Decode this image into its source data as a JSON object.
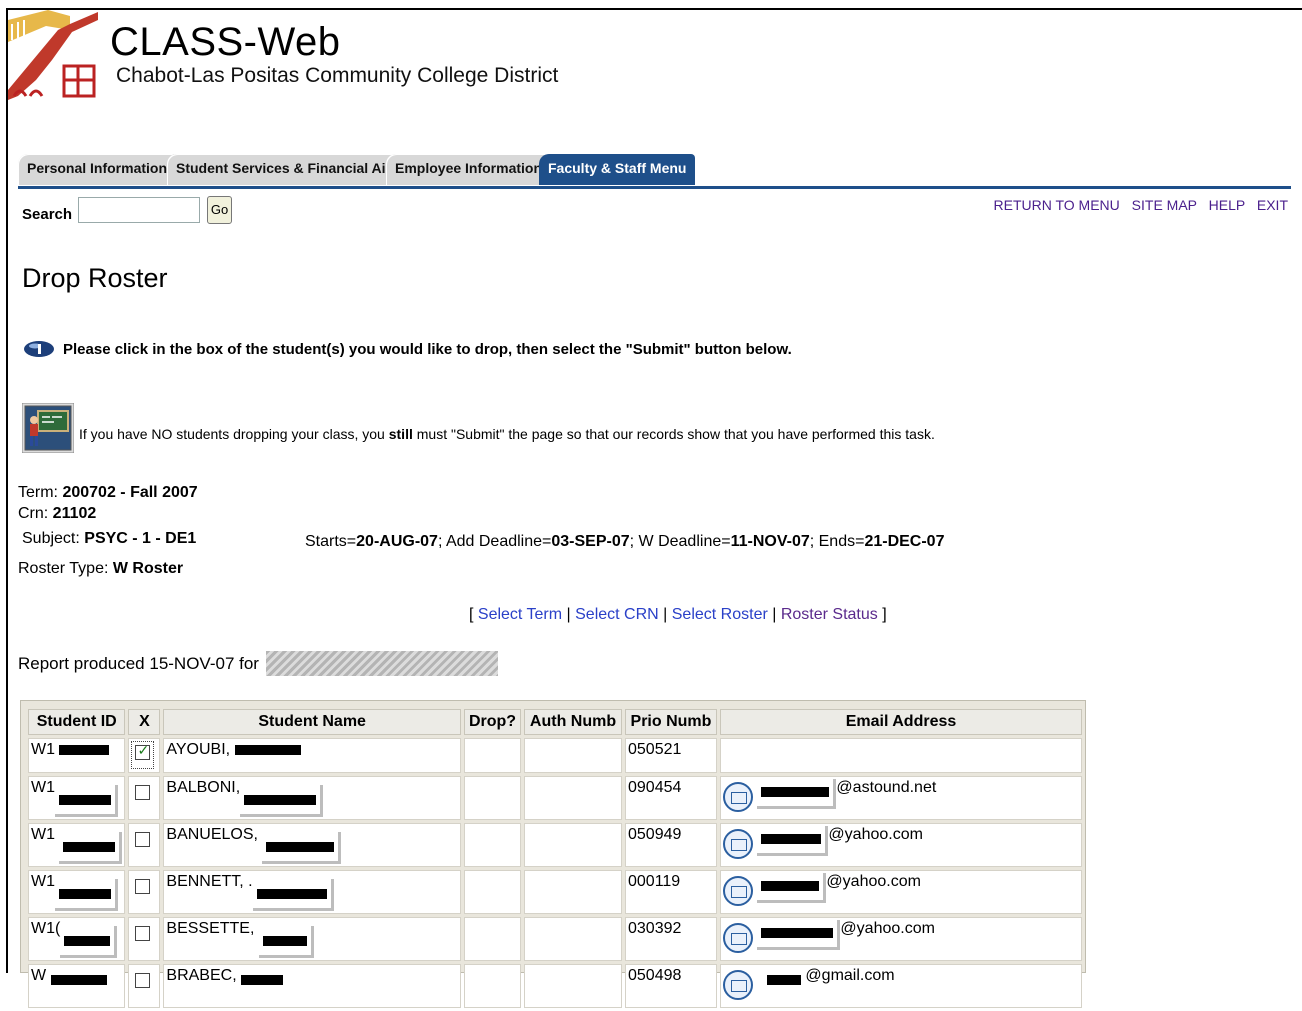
{
  "header": {
    "title": "CLASS-Web",
    "subtitle": "Chabot-Las Positas Community College District",
    "logo": "class-web-logo"
  },
  "tabs": [
    {
      "label": "Personal Information",
      "active": false
    },
    {
      "label": "Student Services & Financial Aid",
      "active": false
    },
    {
      "label": "Employee Information",
      "active": false
    },
    {
      "label": "Faculty & Staff Menu",
      "active": true
    }
  ],
  "search": {
    "label": "Search",
    "value": "",
    "go_label": "Go"
  },
  "toplinks": {
    "return": "RETURN TO MENU",
    "sitemap": "SITE MAP",
    "help": "HELP",
    "exit": "EXIT"
  },
  "page_title": "Drop Roster",
  "instruction": "Please click in the box of the student(s) you would like to drop, then select the \"Submit\" button below.",
  "note": {
    "before": "If you have NO students dropping your class, you ",
    "bold": "still",
    "after": " must \"Submit\" the page so that our records show that you have performed this task."
  },
  "course": {
    "term_label": "Term: ",
    "term": "200702 - Fall 2007",
    "crn_label": "Crn: ",
    "crn": "21102",
    "subject_label": "Subject: ",
    "subject": "PSYC - 1 - DE1",
    "roster_label": "Roster Type: ",
    "roster": "W Roster"
  },
  "dates": {
    "starts_label": "Starts=",
    "starts": "20-AUG-07",
    "add_label": "; Add Deadline=",
    "add": "03-SEP-07",
    "w_label": "; W Deadline=",
    "w": "11-NOV-07",
    "ends_label": "; Ends=",
    "ends": "21-DEC-07"
  },
  "nav_links": {
    "select_term": "Select Term",
    "select_crn": "Select CRN",
    "select_roster": "Select Roster",
    "roster_status": "Roster Status"
  },
  "report": "Report produced 15-NOV-07 for",
  "table": {
    "headers": [
      "Student ID",
      "X",
      "Student Name",
      "Drop?",
      "Auth Numb",
      "Prio Numb",
      "Email Address"
    ],
    "rows": [
      {
        "id": "W1",
        "checked": true,
        "name": "AYOUBI,",
        "prio": "050521",
        "email": ""
      },
      {
        "id": "W1",
        "checked": false,
        "name": "BALBONI,",
        "prio": "090454",
        "email": "@astound.net"
      },
      {
        "id": "W1",
        "checked": false,
        "name": "BANUELOS,",
        "prio": "050949",
        "email": "@yahoo.com"
      },
      {
        "id": "W1",
        "checked": false,
        "name": "BENNETT, .",
        "prio": "000119",
        "email": "@yahoo.com"
      },
      {
        "id": "W1(",
        "checked": false,
        "name": "BESSETTE,",
        "prio": "030392",
        "email": "@yahoo.com"
      },
      {
        "id": "W",
        "checked": false,
        "name": "BRABEC,",
        "prio": "050498",
        "email": "@gmail.com"
      }
    ]
  },
  "colors": {
    "tab_active": "#1e4f8a",
    "link": "#2a40c8",
    "toplink": "#4a1f8c"
  }
}
